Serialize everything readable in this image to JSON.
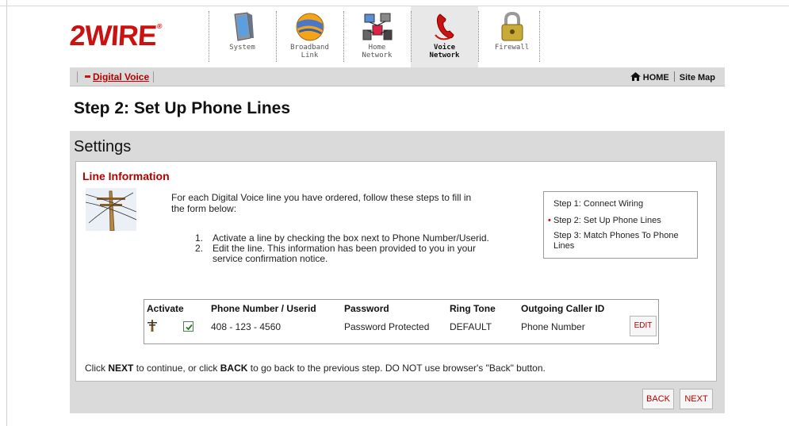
{
  "brand": {
    "logo_text": "2WIRE",
    "trademark": "®"
  },
  "nav": {
    "tabs": [
      {
        "label": "System",
        "active": false
      },
      {
        "label": "Broadband\nLink",
        "active": false
      },
      {
        "label": "Home\nNetwork",
        "active": false
      },
      {
        "label": "Voice\nNetwork",
        "active": true
      },
      {
        "label": "Firewall",
        "active": false
      }
    ]
  },
  "subnav": {
    "digital_voice": "Digital Voice",
    "home": "HOME",
    "site_map": "Site Map"
  },
  "page": {
    "title": "Step 2: Set Up Phone Lines"
  },
  "settings": {
    "title": "Settings",
    "section_title": "Line Information",
    "intro_line1": "For each Digital Voice line you have ordered, follow these steps to fill in",
    "intro_line2": "the form below:",
    "instruction_1_num": "1.",
    "instruction_1": "Activate a line by checking the box next to Phone Number/Userid.",
    "instruction_2_num": "2.",
    "instruction_2a": "Edit the line. This information has been provided to you in your",
    "instruction_2b": "service confirmation notice.",
    "steps": [
      {
        "label": "Step 1: Connect Wiring"
      },
      {
        "label": "Step 2: Set Up Phone Lines"
      },
      {
        "label": "Step 3: Match Phones To Phone Lines"
      }
    ]
  },
  "table": {
    "headers": [
      "Activate",
      "Phone Number / Userid",
      "Password",
      "Ring Tone",
      "Outgoing Caller ID"
    ],
    "row": {
      "activated": true,
      "phone": "408 - 123 - 4560",
      "password": "Password Protected",
      "ring_tone": "DEFAULT",
      "caller_id": "Phone Number",
      "edit_label": "EDIT"
    }
  },
  "footer": {
    "p1": "Click ",
    "next_word": "NEXT",
    "p2": " to continue, or click ",
    "back_word": "BACK",
    "p3": " to go back to the previous step. DO NOT use browser's \"Back\" button."
  },
  "buttons": {
    "back": "BACK",
    "next": "NEXT"
  },
  "colors": {
    "brand_red": "#cc1111",
    "link_red": "#b30000",
    "panel_gray": "#dadada"
  }
}
